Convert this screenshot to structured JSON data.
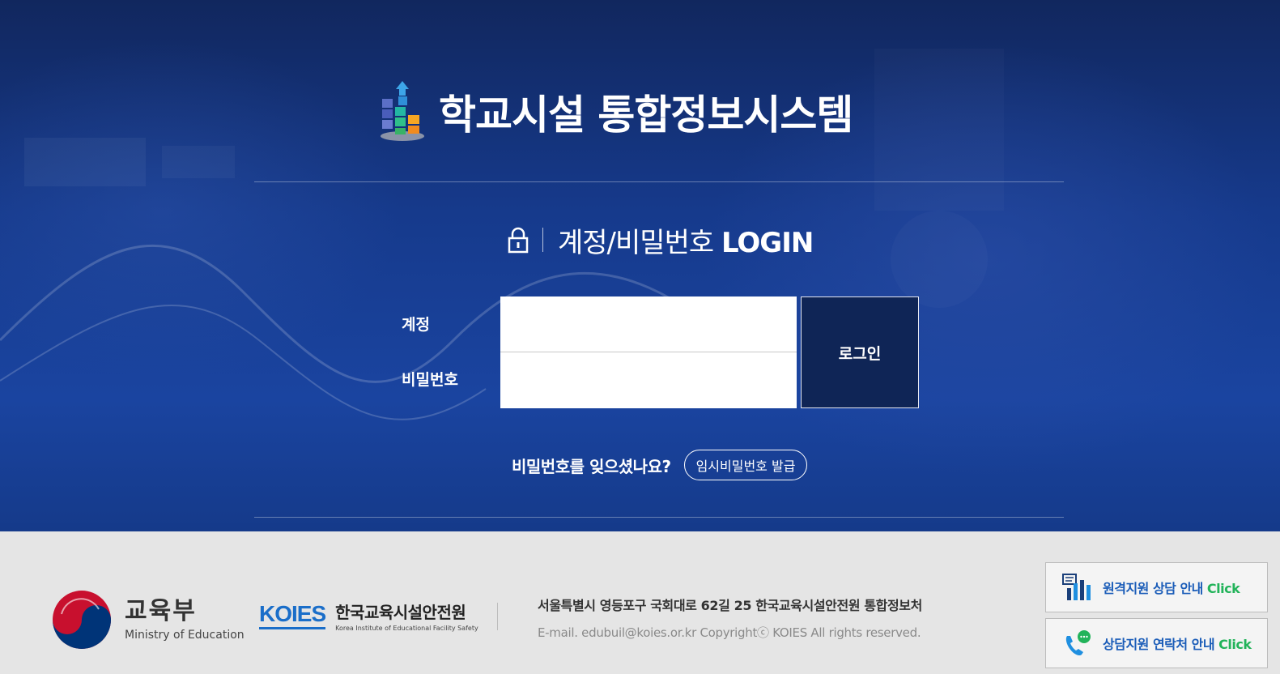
{
  "header": {
    "app_title": "학교시설 통합정보시스템"
  },
  "login": {
    "title_kr": "계정/비밀번호",
    "title_en": "LOGIN",
    "account_label": "계정",
    "password_label": "비밀번호",
    "account_value": "",
    "password_value": "",
    "login_button": "로그인",
    "forgot_text": "비밀번호를 잊으셨나요?",
    "temp_password_button": "임시비밀번호 발급"
  },
  "footer": {
    "ministry_kr": "교육부",
    "ministry_en": "Ministry of Education",
    "koies_mark": "KOIES",
    "koies_kr": "한국교육시설안전원",
    "koies_en": "Korea Institute of Educational Facility Safety",
    "address": "서울특별시 영등포구 국회대로 62길 25 한국교육시설안전원 통합정보처",
    "copyright": "E-mail. edubuil@koies.or.kr Copyrightⓒ KOIES All rights reserved.",
    "remote_support_label": "원격지원 상담 안내",
    "contact_label": "상담지원 연락처 안내",
    "click_word": "Click"
  },
  "colors": {
    "hero_bg": "#163a8c",
    "login_button_bg": "#0f2556",
    "footer_bg": "#e5e5e5",
    "link_blue": "#1a5cb8",
    "click_green": "#22b35a"
  },
  "icons": [
    "building-blocks-logo-icon",
    "lock-icon",
    "ministry-emblem-icon",
    "remote-support-chart-icon",
    "phone-chat-icon"
  ]
}
